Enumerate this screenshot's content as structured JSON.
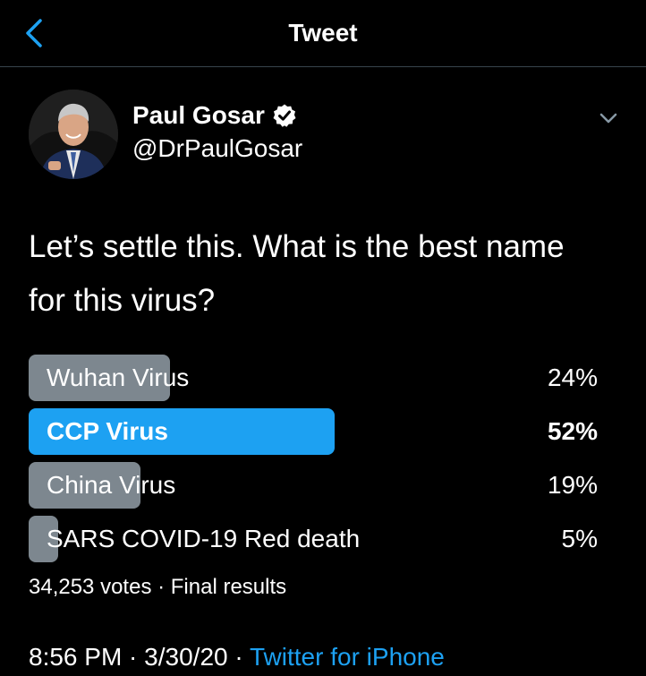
{
  "header": {
    "title": "Tweet"
  },
  "author": {
    "name": "Paul Gosar",
    "handle": "@DrPaulGosar"
  },
  "tweet": {
    "text": "Let’s settle this. What is the best name for this virus?"
  },
  "poll": {
    "options": [
      {
        "label": "Wuhan Virus",
        "percent": 24,
        "percent_label": "24%"
      },
      {
        "label": "CCP Virus",
        "percent": 52,
        "percent_label": "52%",
        "winner": true
      },
      {
        "label": "China Virus",
        "percent": 19,
        "percent_label": "19%"
      },
      {
        "label": "SARS COVID-19 Red death",
        "percent": 5,
        "percent_label": "5%"
      }
    ],
    "summary": "34,253 votes · Final results"
  },
  "meta": {
    "time": "8:56 PM",
    "date": "3/30/20",
    "separator": " · ",
    "source": "Twitter for iPhone"
  },
  "icons": {
    "back": "chevron-left-icon",
    "verified": "verified-badge-icon",
    "more": "chevron-down-icon"
  },
  "colors": {
    "background": "#000000",
    "accent": "#1da1f2",
    "poll_bar": "#7d878f",
    "divider": "#38444d"
  }
}
